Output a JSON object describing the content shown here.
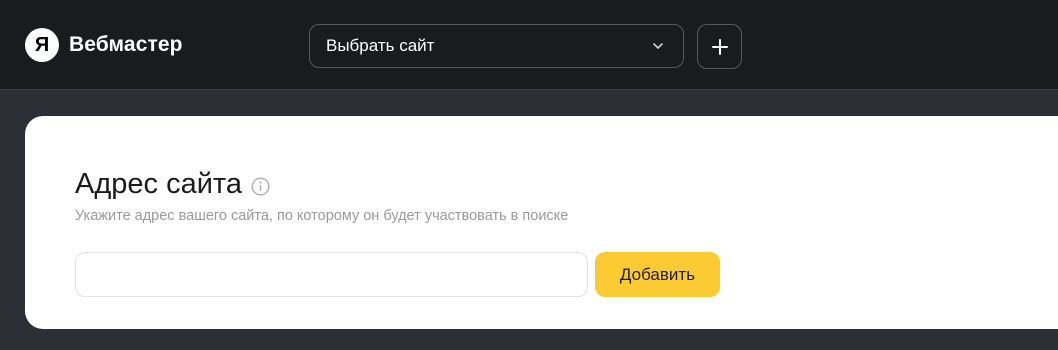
{
  "header": {
    "logo_letter": "Я",
    "app_name": "Вебмастер",
    "site_select": {
      "value": "Выбрать сайт",
      "icon": "chevron-down-icon"
    },
    "add_site_button": {
      "icon": "plus-icon"
    }
  },
  "form": {
    "title": "Адрес сайта",
    "info_icon": "info-icon",
    "hint": "Укажите адрес вашего сайта, по которому он будет участвовать в поиске",
    "url_input": {
      "value": "",
      "placeholder": ""
    },
    "submit_label": "Добавить"
  },
  "colors": {
    "header_bg": "#1a1b1d",
    "page_bg": "#2c2f36",
    "accent": "#fcca32"
  }
}
